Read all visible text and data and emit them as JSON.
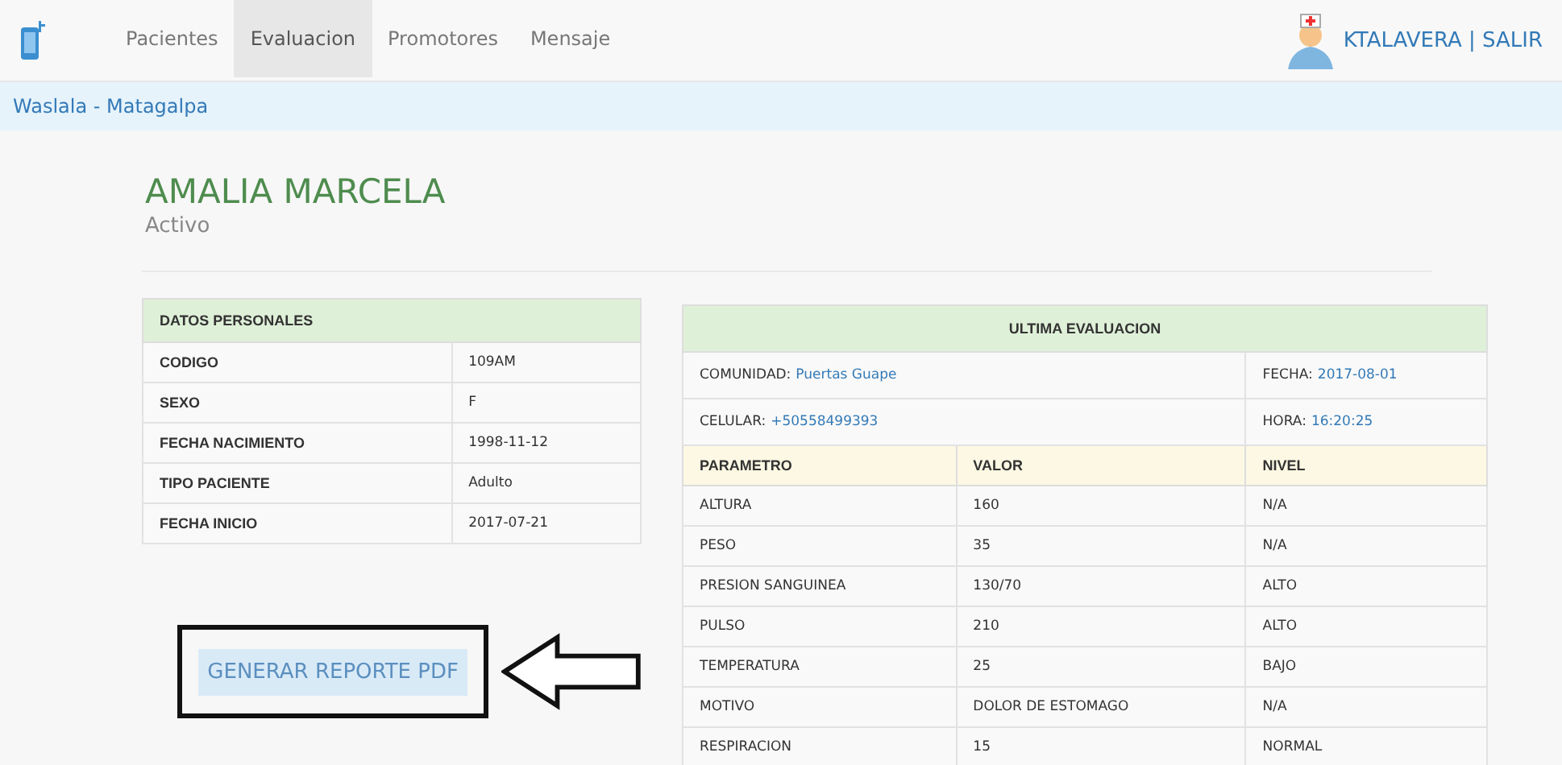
{
  "nav": {
    "tabs": [
      {
        "label": "Pacientes",
        "selected": false
      },
      {
        "label": "Evaluacion",
        "selected": true
      },
      {
        "label": "Promotores",
        "selected": false
      },
      {
        "label": "Mensaje",
        "selected": false
      }
    ],
    "user_link": "KTALAVERA | SALIR"
  },
  "breadcrumb": "Waslala - Matagalpa",
  "patient": {
    "name": "AMALIA MARCELA",
    "status": "Activo"
  },
  "personal": {
    "title": "DATOS PERSONALES",
    "rows": [
      {
        "label": "CODIGO",
        "value": "109AM"
      },
      {
        "label": "SEXO",
        "value": "F"
      },
      {
        "label": "FECHA NACIMIENTO",
        "value": "1998-11-12"
      },
      {
        "label": "TIPO PACIENTE",
        "value": "Adulto"
      },
      {
        "label": "FECHA INICIO",
        "value": "2017-07-21"
      }
    ]
  },
  "report_button": "GENERAR REPORTE PDF",
  "evaluation": {
    "title": "ULTIMA EVALUACION",
    "info": [
      [
        {
          "label": "COMUNIDAD:",
          "value": "Puertas Guape"
        },
        {
          "label": "FECHA:",
          "value": "2017-08-01"
        }
      ],
      [
        {
          "label": "CELULAR:",
          "value": "+50558499393"
        },
        {
          "label": "HORA:",
          "value": "16:20:25"
        }
      ]
    ],
    "columns": [
      "PARAMETRO",
      "VALOR",
      "NIVEL"
    ],
    "rows": [
      [
        "ALTURA",
        "160",
        "N/A"
      ],
      [
        "PESO",
        "35",
        "N/A"
      ],
      [
        "PRESION SANGUINEA",
        "130/70",
        "ALTO"
      ],
      [
        "PULSO",
        "210",
        "ALTO"
      ],
      [
        "TEMPERATURA",
        "25",
        "BAJO"
      ],
      [
        "MOTIVO",
        "DOLOR DE ESTOMAGO",
        "N/A"
      ],
      [
        "RESPIRACION",
        "15",
        "NORMAL"
      ]
    ]
  }
}
